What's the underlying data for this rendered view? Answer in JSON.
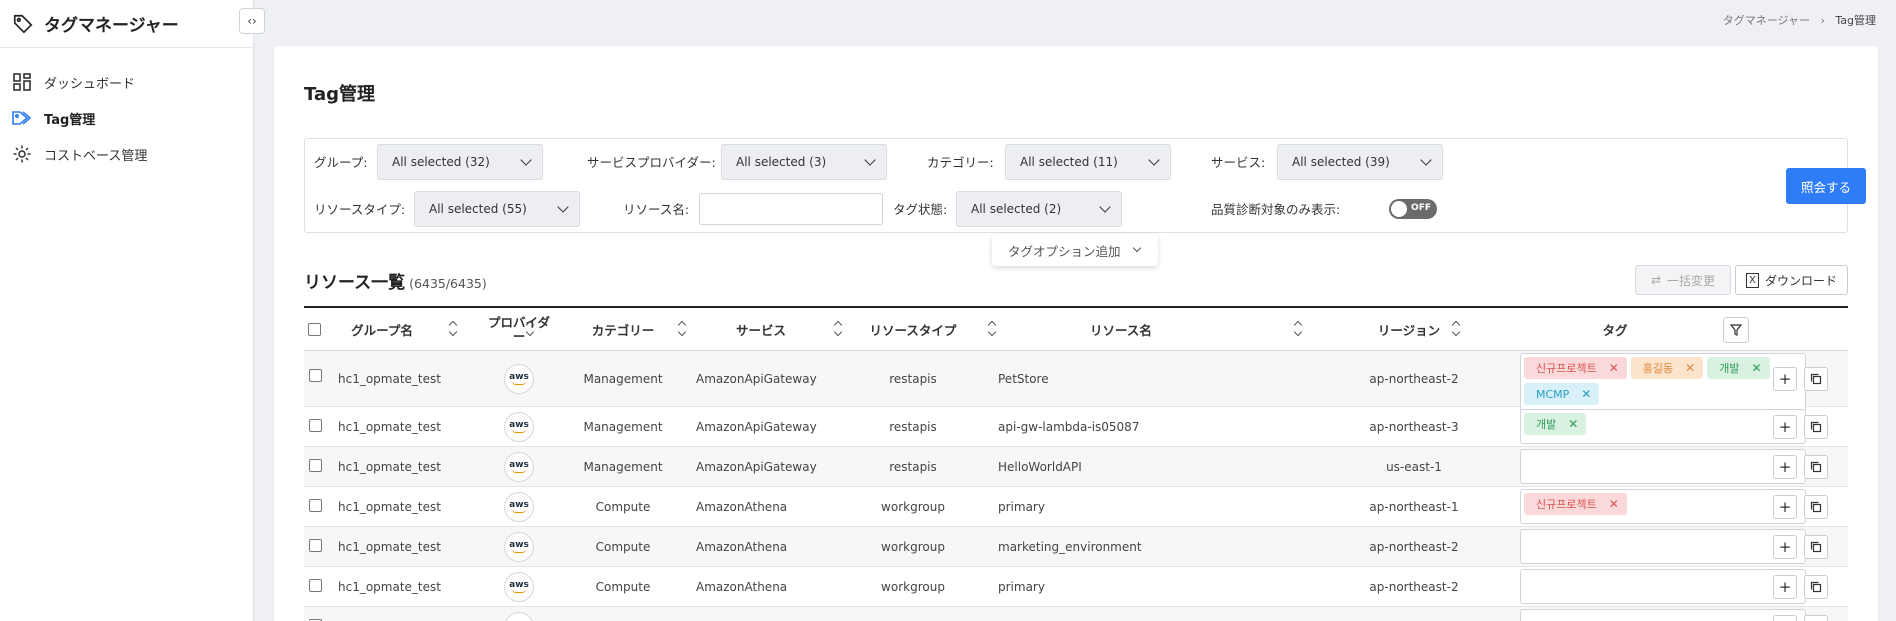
{
  "app": {
    "title": "タグマネージャー"
  },
  "nav": [
    {
      "label": "ダッシュボード",
      "icon": "dashboard-icon"
    },
    {
      "label": "Tag管理",
      "icon": "tag-icon"
    },
    {
      "label": "コストベース管理",
      "icon": "gear-icon"
    }
  ],
  "breadcrumb": {
    "root": "タグマネージャー",
    "sep": "›",
    "current": "Tag管理"
  },
  "page": {
    "title": "Tag管理"
  },
  "filters": {
    "group_label": "グループ:",
    "group_value": "All selected (32)",
    "provider_label": "サービスプロバイダー:",
    "provider_value": "All selected (3)",
    "category_label": "カテゴリー:",
    "category_value": "All selected (11)",
    "service_label": "サービス:",
    "service_value": "All selected (39)",
    "rtype_label": "リソースタイプ:",
    "rtype_value": "All selected (55)",
    "rname_label": "リソース名:",
    "rname_value": "",
    "tagstate_label": "タグ状態:",
    "tagstate_value": "All selected (2)",
    "quality_label": "品質診断対象のみ表示:",
    "toggle_text": "OFF",
    "query_button": "照会する",
    "tag_option": "タグオプション追加"
  },
  "list": {
    "title": "リソース一覧",
    "count": "(6435/6435)",
    "bulk_button": "一括変更",
    "download_button": "ダウンロード",
    "download_icon": "X"
  },
  "columns": {
    "group": "グループ名",
    "provider": "プロバイダー",
    "category": "カテゴリー",
    "service": "サービス",
    "rtype": "リソースタイプ",
    "rname": "リソース名",
    "region": "リージョン",
    "tag": "タグ"
  },
  "rows": [
    {
      "group": "hc1_opmate_test",
      "provider": "aws",
      "category": "Management",
      "service": "AmazonApiGateway",
      "rtype": "restapis",
      "rname": "PetStore",
      "region": "ap-northeast-2",
      "tags": [
        {
          "text": "신규프로젝트",
          "color": "red"
        },
        {
          "text": "홍길동",
          "color": "orange"
        },
        {
          "text": "개발",
          "color": "green"
        },
        {
          "text": "MCMP",
          "color": "cyan"
        }
      ]
    },
    {
      "group": "hc1_opmate_test",
      "provider": "aws",
      "category": "Management",
      "service": "AmazonApiGateway",
      "rtype": "restapis",
      "rname": "api-gw-lambda-is05087",
      "region": "ap-northeast-3",
      "tags": [
        {
          "text": "개발",
          "color": "green"
        }
      ]
    },
    {
      "group": "hc1_opmate_test",
      "provider": "aws",
      "category": "Management",
      "service": "AmazonApiGateway",
      "rtype": "restapis",
      "rname": "HelloWorldAPI",
      "region": "us-east-1",
      "tags": []
    },
    {
      "group": "hc1_opmate_test",
      "provider": "aws",
      "category": "Compute",
      "service": "AmazonAthena",
      "rtype": "workgroup",
      "rname": "primary",
      "region": "ap-northeast-1",
      "tags": [
        {
          "text": "신규프로젝트",
          "color": "red"
        }
      ]
    },
    {
      "group": "hc1_opmate_test",
      "provider": "aws",
      "category": "Compute",
      "service": "AmazonAthena",
      "rtype": "workgroup",
      "rname": "marketing_environment",
      "region": "ap-northeast-2",
      "tags": []
    },
    {
      "group": "hc1_opmate_test",
      "provider": "aws",
      "category": "Compute",
      "service": "AmazonAthena",
      "rtype": "workgroup",
      "rname": "primary",
      "region": "ap-northeast-2",
      "tags": []
    },
    {
      "group": "",
      "provider": "aws",
      "category": "",
      "service": "",
      "rtype": "",
      "rname": "",
      "region": "",
      "tags": []
    }
  ]
}
